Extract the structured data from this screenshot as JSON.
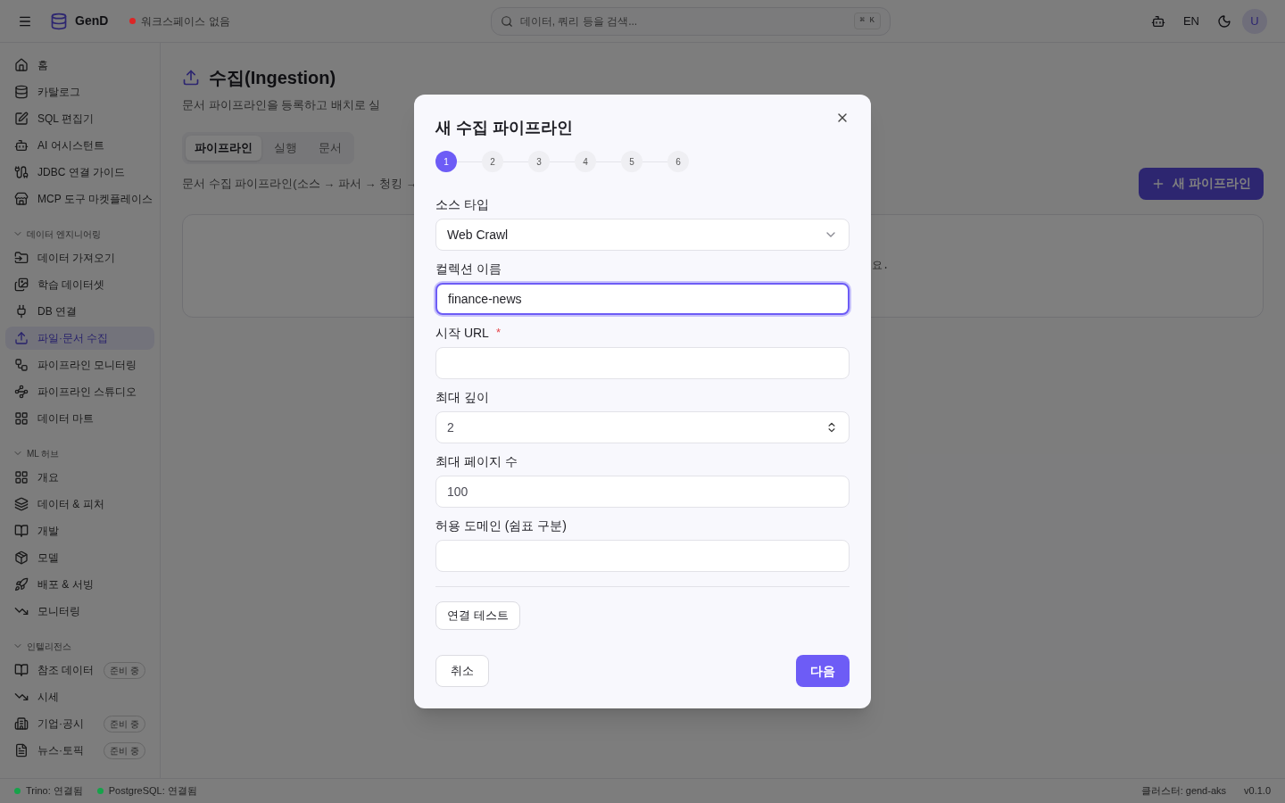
{
  "header": {
    "logo": "GenD",
    "workspace": {
      "label": "워크스페이스 없음",
      "color": "#dc2626"
    },
    "search": {
      "placeholder": "데이터, 쿼리 등을 검색..."
    },
    "shortcut": "⌘ K",
    "language": "EN",
    "avatar": "U"
  },
  "sidebar": {
    "sections": [
      {
        "items": [
          {
            "label": "홈",
            "selected": false
          },
          {
            "label": "카탈로그",
            "selected": false
          },
          {
            "label": "SQL 편집기",
            "selected": false
          },
          {
            "label": "AI 어시스턴트",
            "selected": false
          },
          {
            "label": "JDBC 연결 가이드",
            "selected": false
          },
          {
            "label": "MCP 도구 마켓플레이스",
            "selected": false
          }
        ]
      },
      {
        "title": "데이터 엔지니어링",
        "expanded": true,
        "items": [
          {
            "label": "데이터 가져오기",
            "selected": false
          },
          {
            "label": "학습 데이터셋",
            "selected": false
          },
          {
            "label": "DB 연결",
            "selected": false
          },
          {
            "label": "파일·문서 수집",
            "selected": true
          },
          {
            "label": "파이프라인 모니터링",
            "selected": false
          },
          {
            "label": "파이프라인 스튜디오",
            "selected": false
          },
          {
            "label": "데이터 마트",
            "selected": false
          }
        ]
      },
      {
        "title": "ML 허브",
        "expanded": true,
        "items": [
          {
            "label": "개요",
            "selected": false
          },
          {
            "label": "데이터 & 피처",
            "selected": false
          },
          {
            "label": "개발",
            "selected": false
          },
          {
            "label": "모델",
            "selected": false
          },
          {
            "label": "배포 & 서빙",
            "selected": false
          },
          {
            "label": "모니터링",
            "selected": false
          }
        ]
      },
      {
        "title": "인텔리전스",
        "expanded": true,
        "items": [
          {
            "label": "참조 데이터",
            "selected": false,
            "badge": "준비 중"
          },
          {
            "label": "시세",
            "selected": false
          },
          {
            "label": "기업·공시",
            "selected": false,
            "badge": "준비 중"
          },
          {
            "label": "뉴스·토픽",
            "selected": false,
            "badge": "준비 중"
          }
        ]
      }
    ]
  },
  "main": {
    "title": "수집(Ingestion)",
    "subtitle": "문서 파이프라인을 등록하고 배치로 실",
    "tabs": [
      {
        "label": "파이프라인",
        "selected": true
      },
      {
        "label": "실행",
        "selected": false
      },
      {
        "label": "문서",
        "selected": false
      }
    ],
    "description": "문서 수집 파이프라인(소스 → 파서 → 청킹 →",
    "new_button": "새 파이프라인",
    "card_text": "요."
  },
  "dialog": {
    "title": "새 수집 파이프라인",
    "steps": [
      {
        "label": "1",
        "selected": true
      },
      {
        "label": "2",
        "selected": false
      },
      {
        "label": "3",
        "selected": false
      },
      {
        "label": "4",
        "selected": false
      },
      {
        "label": "5",
        "selected": false
      },
      {
        "label": "6",
        "selected": false
      }
    ],
    "fields": [
      {
        "kind": "select",
        "label": "소스 타입",
        "value": "Web Crawl",
        "required": false,
        "focused": false
      },
      {
        "kind": "text",
        "label": "컬렉션 이름",
        "value": "finance-news",
        "required": false,
        "focused": true
      },
      {
        "kind": "text",
        "label": "시작 URL",
        "required": true,
        "focused": false
      },
      {
        "kind": "number",
        "label": "최대 깊이",
        "value": "2",
        "required": false,
        "focused": false
      },
      {
        "kind": "text",
        "label": "최대 페이지 수",
        "value": "100",
        "required": false,
        "focused": false
      },
      {
        "kind": "text",
        "label": "허용 도메인 (쉼표 구분)",
        "required": false,
        "focused": false
      }
    ],
    "required_mark": "*",
    "test_button": "연결 테스트",
    "cancel_button": "취소",
    "next_button": "다음"
  },
  "status_bar": {
    "connections": [
      {
        "label": "Trino: 연결됨",
        "color": "#16a34a"
      },
      {
        "label": "PostgreSQL: 연결됨",
        "color": "#16a34a"
      }
    ],
    "cluster": "클러스터: gend-aks",
    "version": "v0.1.0"
  }
}
